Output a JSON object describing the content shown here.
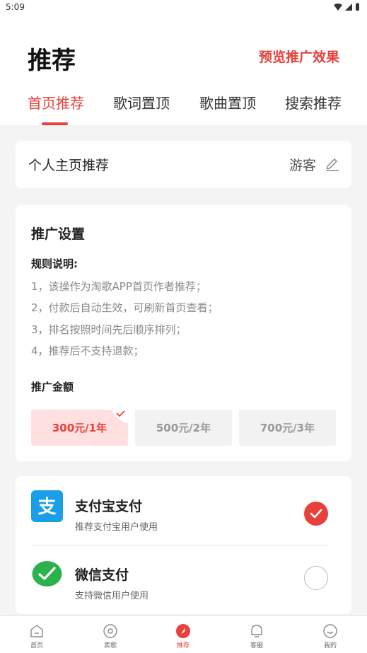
{
  "status_bar": {
    "time": "5:09"
  },
  "header": {
    "title": "推荐",
    "preview_link": "预览推广效果",
    "tabs": [
      {
        "label": "首页推荐",
        "active": true
      },
      {
        "label": "歌词置顶",
        "active": false
      },
      {
        "label": "歌曲置顶",
        "active": false
      },
      {
        "label": "搜索推荐",
        "active": false
      }
    ]
  },
  "profile_card": {
    "title": "个人主页推荐",
    "user": "游客",
    "edit_icon": "edit-icon"
  },
  "settings": {
    "title": "推广设置",
    "rules_title": "规则说明:",
    "rules": [
      "1，该操作为淘歌APP首页作者推荐；",
      "2，付款后自动生效，可刷新首页查看；",
      "3，排名按照时间先后顺序排列；",
      "4，推荐后不支持退款；"
    ],
    "amount_title": "推广金额",
    "prices": [
      {
        "label": "300元/1年",
        "selected": true
      },
      {
        "label": "500元/2年",
        "selected": false
      },
      {
        "label": "700元/3年",
        "selected": false
      }
    ]
  },
  "payment": {
    "methods": [
      {
        "name": "支付宝支付",
        "desc": "推荐支付宝用户使用",
        "icon": "alipay-icon",
        "selected": true
      },
      {
        "name": "微信支付",
        "desc": "支持微信用户使用",
        "icon": "wechat-icon",
        "selected": false
      }
    ]
  },
  "bottom_nav": [
    {
      "label": "首页",
      "icon": "home-icon",
      "active": false
    },
    {
      "label": "卖歌",
      "icon": "disc-icon",
      "active": false
    },
    {
      "label": "推荐",
      "icon": "recommend-icon",
      "active": true
    },
    {
      "label": "客服",
      "icon": "service-icon",
      "active": false
    },
    {
      "label": "我的",
      "icon": "profile-icon",
      "active": false
    }
  ],
  "colors": {
    "accent": "#e8403a",
    "alipay": "#1a9ee8",
    "wechat": "#2bb24c"
  }
}
